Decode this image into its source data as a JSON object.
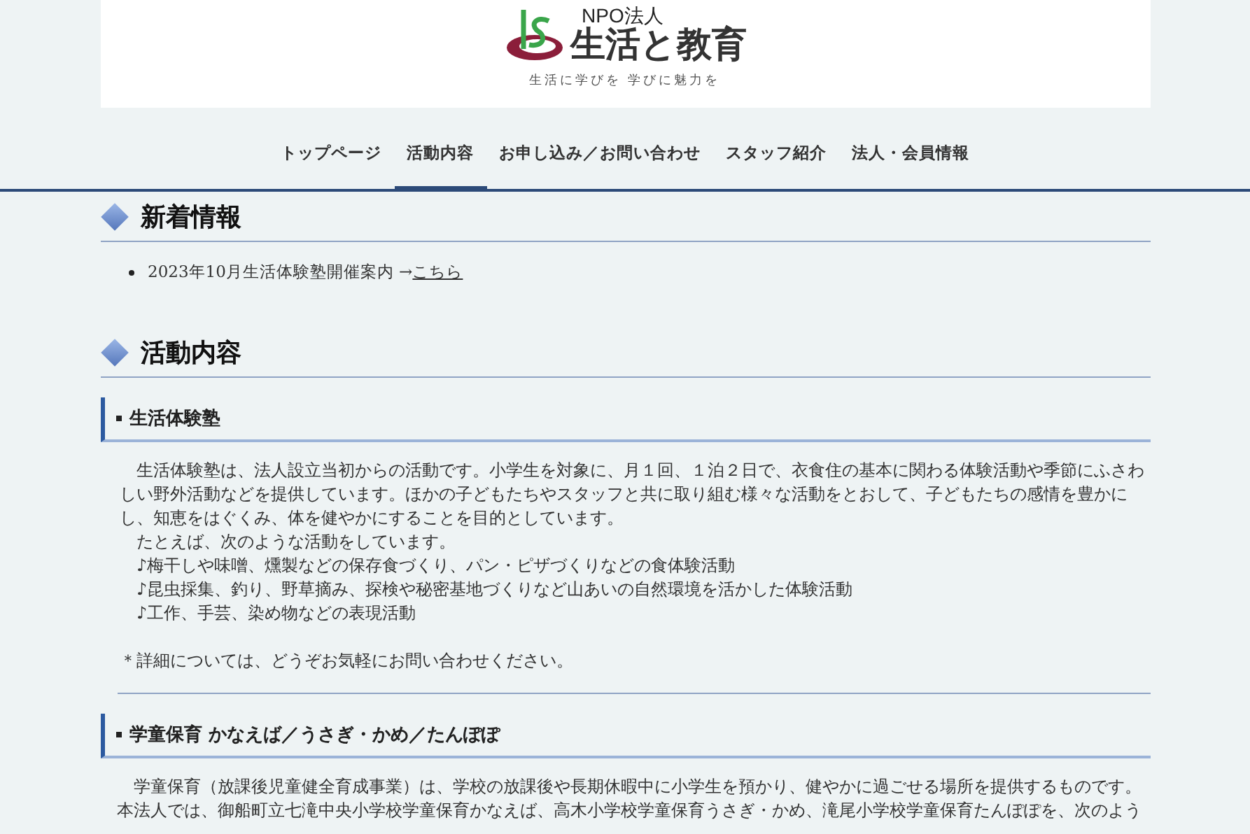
{
  "header": {
    "logo_org": "NPO法人",
    "logo_name": "生活と教育",
    "tagline": "生活に学びを 学びに魅力を"
  },
  "nav": [
    {
      "label": "トップページ",
      "selected": false
    },
    {
      "label": "活動内容",
      "selected": true
    },
    {
      "label": "お申し込み／お問い合わせ",
      "selected": false
    },
    {
      "label": "スタッフ紹介",
      "selected": false
    },
    {
      "label": "法人・会員情報",
      "selected": false
    }
  ],
  "news": {
    "title": "新着情報",
    "items": [
      {
        "text": "2023年10月生活体験塾開催案内 →",
        "link": "こちら"
      }
    ]
  },
  "activities": {
    "title": "活動内容",
    "subsections": [
      {
        "title": "生活体験塾",
        "paragraphs": [
          {
            "kind": "body",
            "text": "生活体験塾は、法人設立当初からの活動です。小学生を対象に、月１回、１泊２日で、衣食住の基本に関わる体験活動や季節にふさわしい野外活動などを提供しています。ほかの子どもたちやスタッフと共に取り組む様々な活動をとおして、子どもたちの感情を豊かにし、知恵をはぐくみ、体を健やかにすることを目的としています。"
          },
          {
            "kind": "body",
            "text": "たとえば、次のような活動をしています。"
          },
          {
            "kind": "body",
            "text": "♪梅干しや味噌、燻製などの保存食づくり、パン・ピザづくりなどの食体験活動"
          },
          {
            "kind": "body",
            "text": "♪昆虫採集、釣り、野草摘み、探検や秘密基地づくりなど山あいの自然環境を活かした体験活動"
          },
          {
            "kind": "body",
            "text": "♪工作、手芸、染め物などの表現活動"
          },
          {
            "kind": "note",
            "text": "＊詳細については、どうぞお気軽にお問い合わせください。"
          }
        ]
      },
      {
        "title": "学童保育 かなえば／うさぎ・かめ／たんぽぽ",
        "paragraphs": [
          {
            "kind": "body",
            "text": "学童保育（放課後児童健全育成事業）は、学校の放課後や長期休暇中に小学生を預かり、健やかに過ごせる場所を提供するものです。本法人では、御船町立七滝中央小学校学童保育かなえば、高木小学校学童保育うさぎ・かめ、滝尾小学校学童保育たんぽぽを、次のよう"
          }
        ]
      }
    ]
  }
}
